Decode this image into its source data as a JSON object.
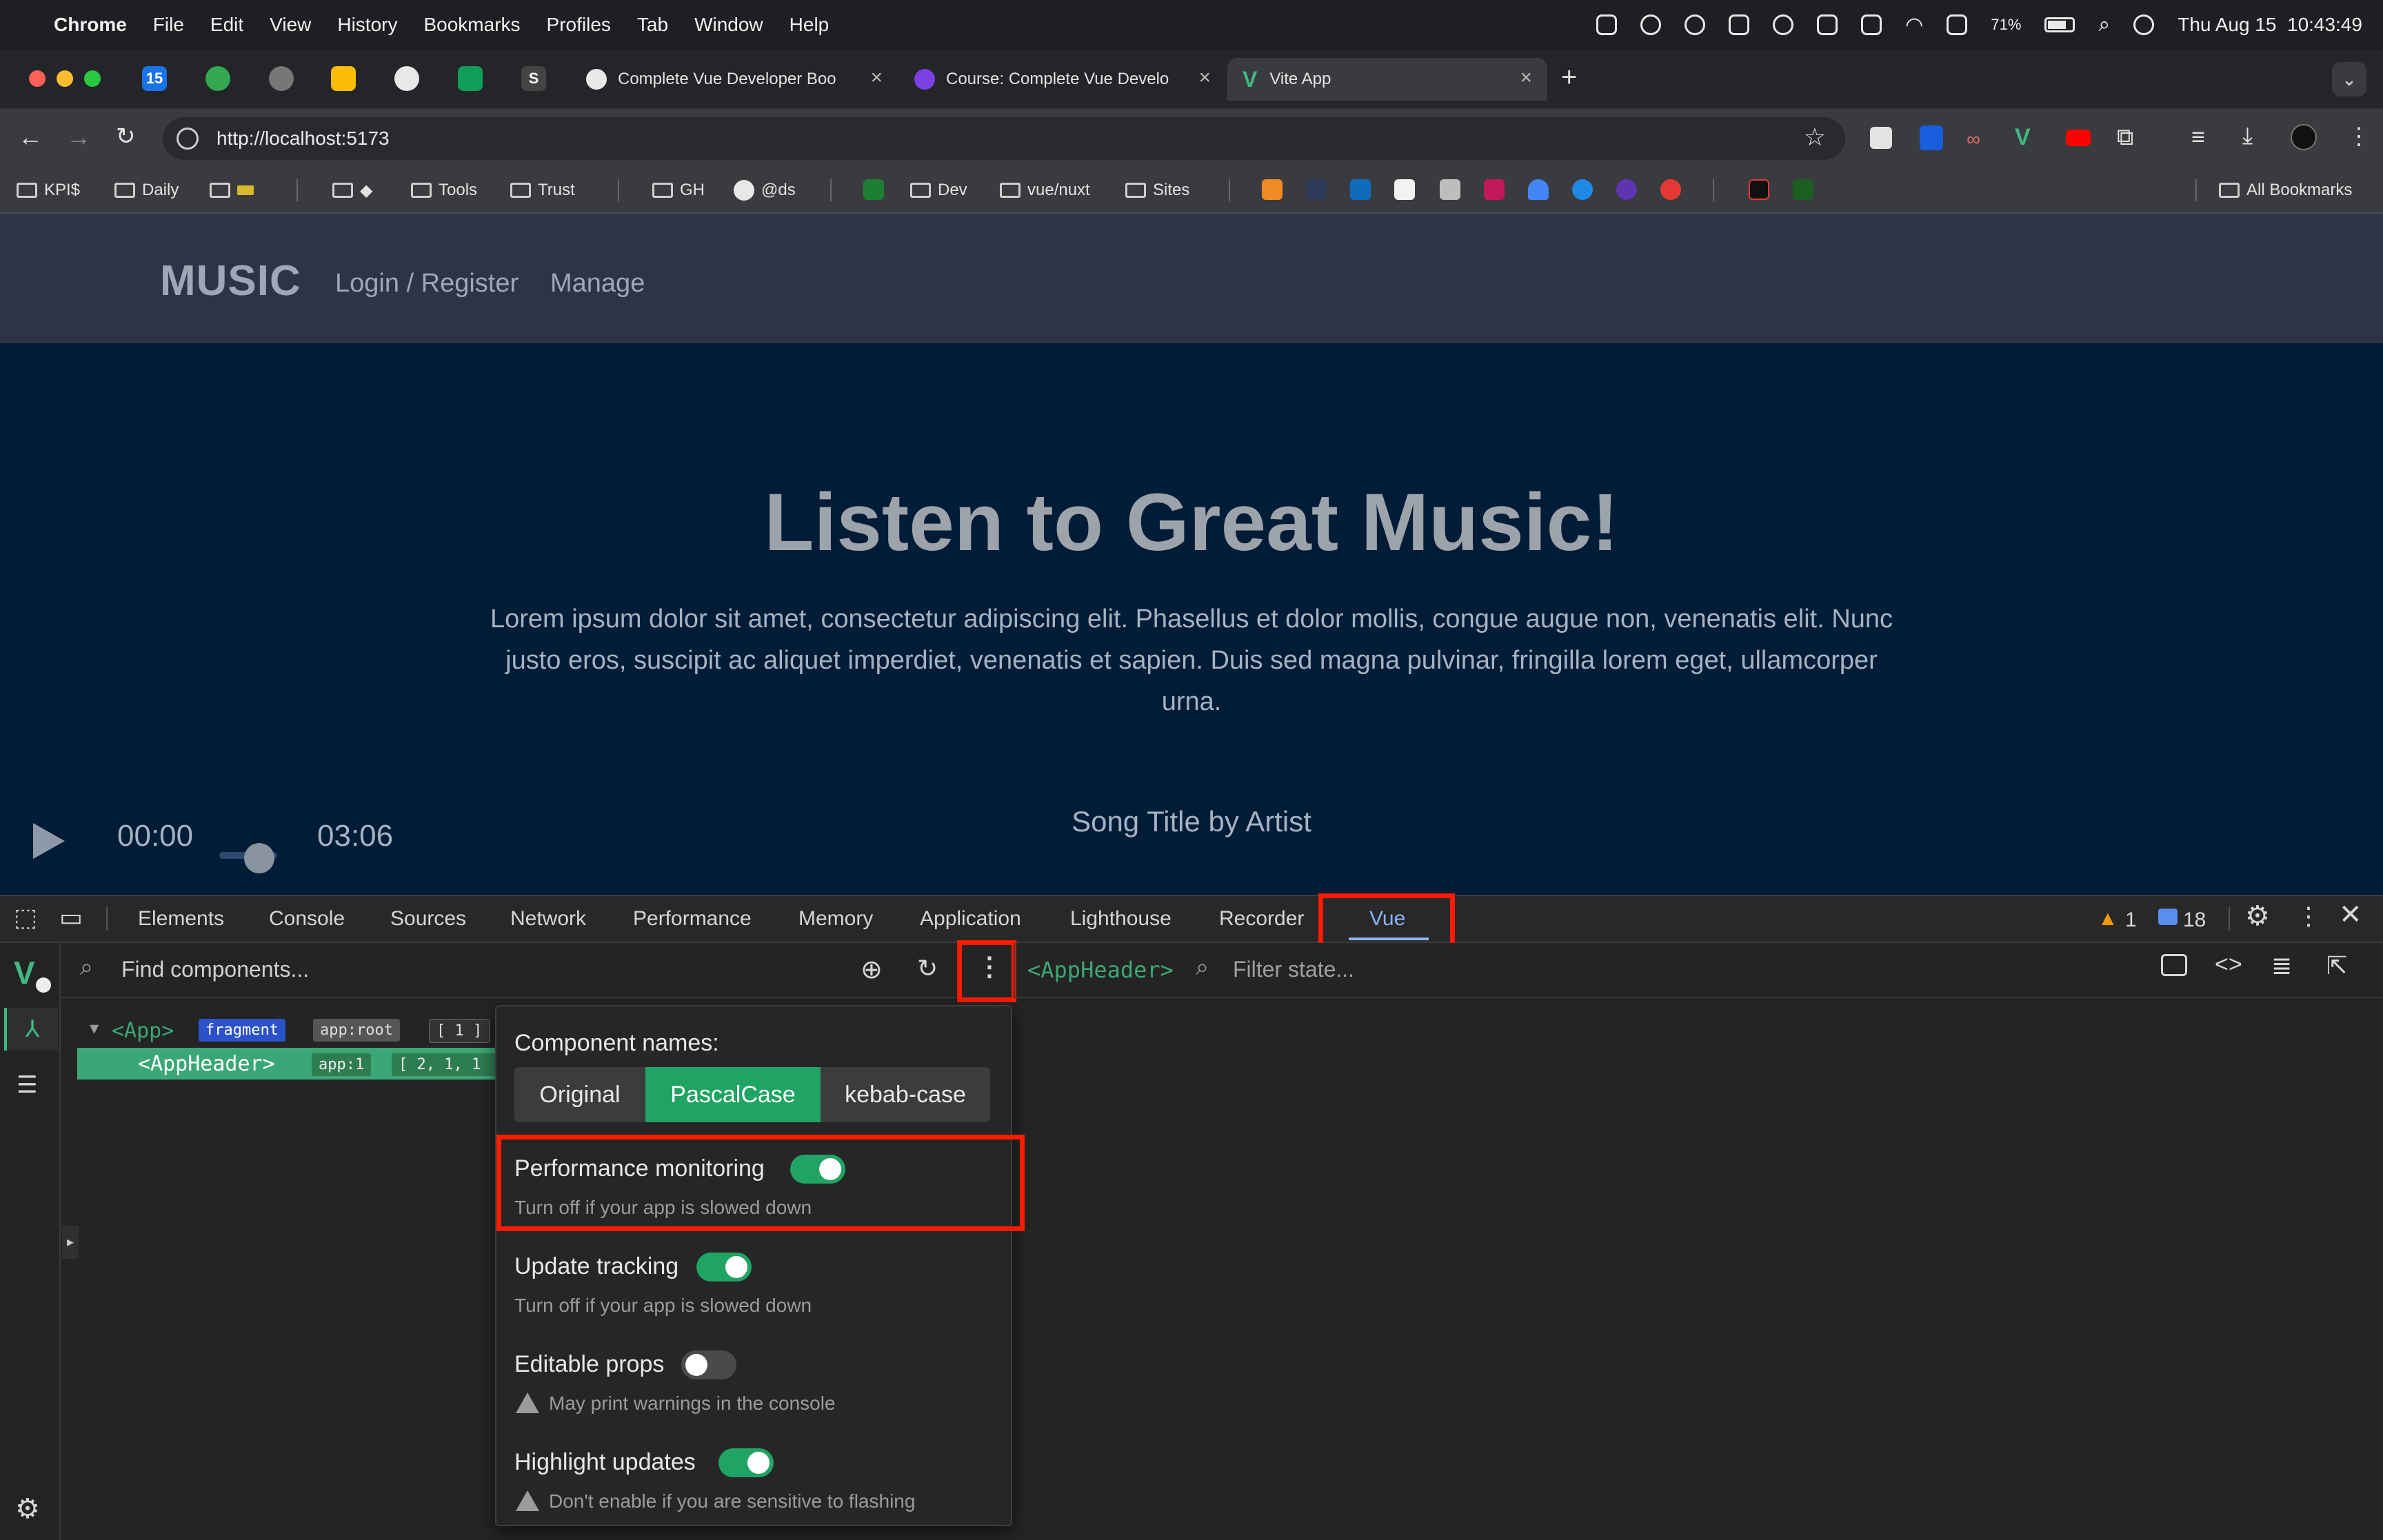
{
  "menubar": {
    "app": "Chrome",
    "items": [
      "File",
      "Edit",
      "View",
      "History",
      "Bookmarks",
      "Profiles",
      "Tab",
      "Window",
      "Help"
    ],
    "battery": "71%",
    "clock": "Thu Aug 15  10:43:49"
  },
  "tabs": [
    {
      "label": "Complete Vue Developer Boo",
      "icon": "github-icon"
    },
    {
      "label": "Course: Complete Vue Develo",
      "icon": "zero-to-mastery-icon"
    },
    {
      "label": "Vite App",
      "icon": "vue-logo-icon",
      "active": true
    }
  ],
  "pinned_tabs": [
    "15",
    "",
    "",
    "",
    "",
    "",
    "S"
  ],
  "address": {
    "url": "http://localhost:5173"
  },
  "bookmarks": [
    {
      "label": "KPI$",
      "type": "folder"
    },
    {
      "label": "Daily",
      "type": "folder"
    },
    {
      "label": "",
      "type": "folder"
    },
    {
      "label": "",
      "type": "folder"
    },
    {
      "label": "Tools",
      "type": "folder"
    },
    {
      "label": "Trust",
      "type": "folder"
    },
    {
      "label": "GH",
      "type": "folder"
    },
    {
      "label": "@ds",
      "type": "link"
    },
    {
      "label": "Dev",
      "type": "folder"
    },
    {
      "label": "vue/nuxt",
      "type": "folder"
    },
    {
      "label": "Sites",
      "type": "folder"
    }
  ],
  "all_bookmarks": "All Bookmarks",
  "site": {
    "logo": "MUSIC",
    "nav": [
      "Login / Register",
      "Manage"
    ],
    "hero_title": "Listen to Great Music!",
    "hero_text": "Lorem ipsum dolor sit amet, consectetur adipiscing elit. Phasellus et dolor mollis, congue augue non, venenatis elit. Nunc justo eros, suscipit ac aliquet imperdiet, venenatis et sapien. Duis sed magna pulvinar, fringilla lorem eget, ullamcorper urna.",
    "player": {
      "current": "00:00",
      "total": "03:06",
      "song": "Song Title by Artist",
      "progress": 0
    }
  },
  "devtools": {
    "tabs": [
      "Elements",
      "Console",
      "Sources",
      "Network",
      "Performance",
      "Memory",
      "Application",
      "Lighthouse",
      "Recorder",
      "Vue"
    ],
    "active_tab": "Vue",
    "warnings": "1",
    "messages": "18",
    "vue": {
      "find_placeholder": "Find components...",
      "filter_placeholder": "Filter state...",
      "selected": "<AppHeader>",
      "tree": [
        {
          "name": "<App>",
          "badges": [
            "fragment",
            "app:root",
            "[ 1 ]"
          ]
        },
        {
          "name": "<AppHeader>",
          "badges": [
            "app:1",
            "[ 2, 1, 1"
          ]
        }
      ],
      "settings": {
        "component_names_label": "Component names:",
        "name_options": [
          "Original",
          "PascalCase",
          "kebab-case"
        ],
        "name_selected": "PascalCase",
        "options": [
          {
            "label": "Performance monitoring",
            "help": "Turn off if your app is slowed down",
            "on": true,
            "warn": false
          },
          {
            "label": "Update tracking",
            "help": "Turn off if your app is slowed down",
            "on": true,
            "warn": false
          },
          {
            "label": "Editable props",
            "help": "May print warnings in the console",
            "on": false,
            "warn": true
          },
          {
            "label": "Highlight updates",
            "help": "Don't enable if you are sensitive to flashing",
            "on": true,
            "warn": true
          }
        ]
      }
    }
  },
  "colors": {
    "vue_green": "#1fa463",
    "annotation_red": "#ff1a00",
    "hero_bg": "#001c36",
    "header_bg": "#2c3446"
  }
}
